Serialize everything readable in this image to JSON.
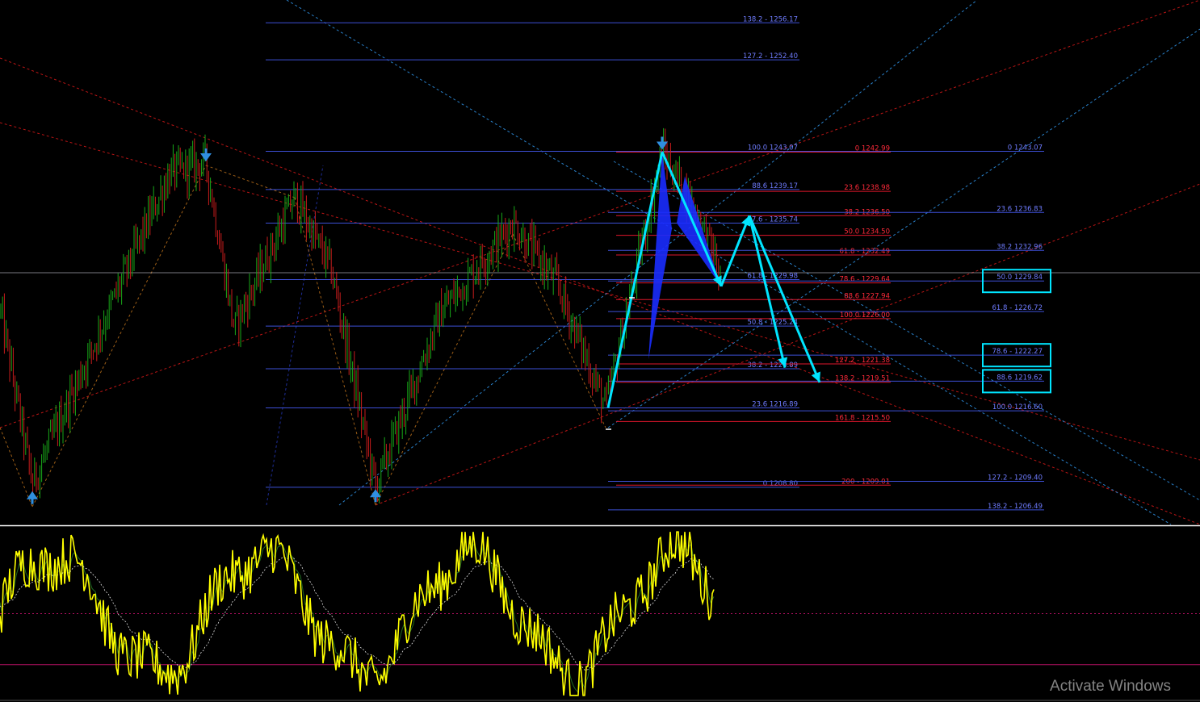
{
  "watermark": "Activate Windows",
  "colors": {
    "background": "#000000",
    "fib_blue": "#3d4fd6",
    "fib_blue_text": "#6f7cff",
    "fib_red": "#e0162b",
    "fib_red_text": "#ff2a3a",
    "channel_red": "#d01818",
    "trend_blue": "#2f8fe0",
    "pattern_cyan": "#00e5ff",
    "pattern_fill": "#1a2cff",
    "candle_up": "#18a818",
    "candle_down": "#c81c1c",
    "osc_main": "#ffff00",
    "osc_signal": "#1f6b1f",
    "osc_level": "#b01060",
    "separator": "#ffffff"
  },
  "chart_data": [
    {
      "type": "candlestick",
      "panel": "price",
      "title": "",
      "y_scale": {
        "min": 1205.0,
        "max": 1258.5
      },
      "price_path_x": [
        0,
        40,
        130,
        210,
        255,
        290,
        365,
        410,
        465,
        545,
        635,
        690,
        750,
        820,
        855,
        880,
        893
      ],
      "price_path_y": [
        1227.0,
        1209.2,
        1226.0,
        1240.8,
        1242.0,
        1225.0,
        1238.4,
        1231.0,
        1208.8,
        1226.5,
        1235.8,
        1229.5,
        1216.9,
        1243.0,
        1238.0,
        1233.5,
        1229.5
      ],
      "fib_sets": [
        {
          "color": "fib_blue",
          "levels": [
            {
              "label": "138.2 - 1256.17",
              "price": 1256.17
            },
            {
              "label": "127.2 - 1252.40",
              "price": 1252.4
            },
            {
              "label": "100.0 1243.07",
              "price": 1243.07
            },
            {
              "label": "88.6 1239.17",
              "price": 1239.17
            },
            {
              "label": "7.6 - 1235.74",
              "price": 1235.74
            },
            {
              "label": "61.8 - 1229.98",
              "price": 1229.98
            },
            {
              "label": "50.8 - 1225.24",
              "price": 1225.24
            },
            {
              "label": "38.2 - 1220.89",
              "price": 1220.89
            },
            {
              "label": "23.6 1216.89",
              "price": 1216.89
            },
            {
              "label": "0 1208.80",
              "price": 1208.8
            }
          ]
        },
        {
          "color": "fib_red",
          "levels": [
            {
              "label": "0 1242.99",
              "price": 1242.99
            },
            {
              "label": "23.6 1238.98",
              "price": 1238.98
            },
            {
              "label": "38.2 1236.50",
              "price": 1236.5
            },
            {
              "label": "50.0 1234.50",
              "price": 1234.5
            },
            {
              "label": "61.8 - 1232.49",
              "price": 1232.49
            },
            {
              "label": "78.6 - 1229.64",
              "price": 1229.64
            },
            {
              "label": "88.6 1227.94",
              "price": 1227.94
            },
            {
              "label": "100.0 1226.00",
              "price": 1226.0
            },
            {
              "label": "127.2 - 1221.38",
              "price": 1221.38
            },
            {
              "label": "138.2 - 1219.51",
              "price": 1219.51
            },
            {
              "label": "161.8 - 1215.50",
              "price": 1215.5
            },
            {
              "label": "200 - 1209.01",
              "price": 1209.01
            }
          ]
        },
        {
          "color": "fib_blue",
          "levels": [
            {
              "label": "0 1243.07",
              "price": 1243.07
            },
            {
              "label": "23.6 1236.83",
              "price": 1236.83
            },
            {
              "label": "38.2 1232.96",
              "price": 1232.96
            },
            {
              "label": "50.0 1229.84",
              "price": 1229.84,
              "boxed": true
            },
            {
              "label": "61.8 - 1226.72",
              "price": 1226.72
            },
            {
              "label": "78.6 - 1222.27",
              "price": 1222.27,
              "boxed": true
            },
            {
              "label": "88.6 1219.62",
              "price": 1219.62,
              "boxed": true
            },
            {
              "label": "100.0 1216.60",
              "price": 1216.6
            },
            {
              "label": "127.2 - 1209.40",
              "price": 1209.4
            },
            {
              "label": "138.2 - 1206.49",
              "price": 1206.49
            }
          ]
        }
      ],
      "pivot_arrows": [
        {
          "direction": "down",
          "price": 1242.2
        },
        {
          "direction": "down",
          "price": 1243.4
        },
        {
          "direction": "up",
          "price": 1208.4
        },
        {
          "direction": "up",
          "price": 1208.6
        }
      ],
      "harmonic_pattern": {
        "points_price": [
          1216.9,
          1243.0,
          1229.3,
          1236.5,
          1221.0,
          1219.5
        ]
      }
    },
    {
      "type": "line",
      "panel": "oscillator",
      "title": "",
      "y_scale": {
        "min": 0,
        "max": 100
      },
      "levels": [
        50,
        20
      ],
      "series": [
        {
          "color": "osc_main"
        },
        {
          "color": "osc_signal"
        }
      ]
    }
  ]
}
